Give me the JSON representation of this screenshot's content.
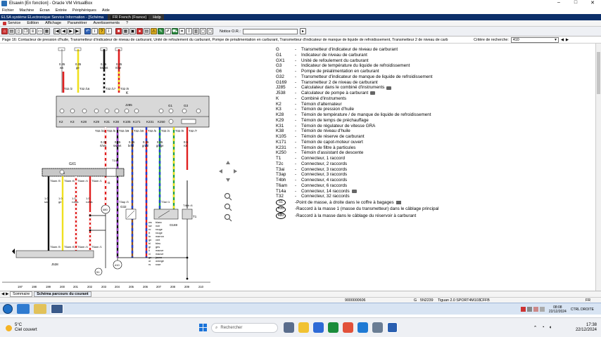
{
  "window": {
    "title": "Elsawin [En fonction] - Oracle VM VirtualBox",
    "controls": [
      "–",
      "□",
      "✕"
    ]
  },
  "vbox_menu": [
    "Fichier",
    "Machine",
    "Écran",
    "Entrée",
    "Périphériques",
    "Aide"
  ],
  "guest_window": {
    "title": "ELSA système ELectronique Service Information - [Schéma",
    "lang": "FR French (France)",
    "help": "Help"
  },
  "elsa_menu": [
    "Service",
    "Edition",
    "Affichage",
    "Paramètrer",
    "Avertissements",
    "?"
  ],
  "notice": {
    "label": "Notice O.R.:",
    "value": ""
  },
  "page": {
    "title": "Page 16: Contacteur de pression d'huile, Transmetteur d'indicateur de niveau de carburant, Unité de refoulement du carburant, Pompe de préalimentation en carburant, Transmetteur d'indicateur de manque de liquide de refroidissement, Transmetteur 2 de niveau de carb"
  },
  "search_criteria": {
    "label": "Critère de recherche:",
    "value": "410"
  },
  "legend": [
    {
      "code": "G",
      "desc": "Transmetteur d'indicateur de niveau de carburant",
      "cam": false
    },
    {
      "code": "G1",
      "desc": "Indicateur de niveau de carburant",
      "cam": false
    },
    {
      "code": "GX1",
      "desc": "Unité de refoulement du carburant",
      "cam": false
    },
    {
      "code": "G3",
      "desc": "Indicateur de température du liquide de refroidissement",
      "cam": false
    },
    {
      "code": "G6",
      "desc": "Pompe de préalimentation en carburant",
      "cam": false
    },
    {
      "code": "G32",
      "desc": "Transmetteur d'indicateur de manque de liquide de refroidissement",
      "cam": false
    },
    {
      "code": "G169",
      "desc": "Transmetteur 2 de niveau de carburant",
      "cam": false
    },
    {
      "code": "J285",
      "desc": "Calculateur dans le combiné d'instruments",
      "cam": true
    },
    {
      "code": "J538",
      "desc": "Calculateur de pompe à carburant",
      "cam": true
    },
    {
      "code": "K",
      "desc": "Combiné d'instruments",
      "cam": false
    },
    {
      "code": "K2",
      "desc": "Témoin d'alternateur",
      "cam": false
    },
    {
      "code": "K3",
      "desc": "Témoin de pression d'huile",
      "cam": false
    },
    {
      "code": "K28",
      "desc": "Témoin de température / de manque de liquide de refroidissement",
      "cam": false
    },
    {
      "code": "K29",
      "desc": "Témoin de temps de préchauffage",
      "cam": false
    },
    {
      "code": "K31",
      "desc": "Témoin de régulateur de vitesse GRA",
      "cam": false
    },
    {
      "code": "K38",
      "desc": "Témoin de niveau d'huile",
      "cam": false
    },
    {
      "code": "K105",
      "desc": "Témoin de réserve de carburant",
      "cam": false
    },
    {
      "code": "K171",
      "desc": "Témoin de capot-moteur ouvert",
      "cam": false
    },
    {
      "code": "K231",
      "desc": "Témoin de filtre à particules",
      "cam": false
    },
    {
      "code": "K250",
      "desc": "Témoin d'assistant de descente",
      "cam": false
    },
    {
      "code": "T1",
      "desc": "Connecteur, 1 raccord",
      "cam": false
    },
    {
      "code": "T2c",
      "desc": "Connecteur, 2 raccords",
      "cam": false
    },
    {
      "code": "T3ai",
      "desc": "Connecteur, 3 raccords",
      "cam": false
    },
    {
      "code": "T3ap",
      "desc": "Connecteur, 3 raccords",
      "cam": false
    },
    {
      "code": "T4bh",
      "desc": "Connecteur, 4 raccords",
      "cam": false
    },
    {
      "code": "T6am",
      "desc": "Connecteur, 6 raccords",
      "cam": false
    },
    {
      "code": "T14a",
      "desc": "Connecteur, 14 raccords",
      "cam": true
    },
    {
      "code": "T32",
      "desc": "Connecteur, 32 raccords",
      "cam": false
    }
  ],
  "legend_symbols": [
    {
      "code": "51",
      "desc": "Point de masse, à droite dans le coffre à bagages",
      "cam": true
    },
    {
      "code": "410",
      "desc": "Raccord à la masse 1 (masse du transmetteur) dans le câblage principal",
      "cam": false
    },
    {
      "code": "480",
      "desc": "Raccord à la masse dans le câblage du réservoir à carburant",
      "cam": false
    }
  ],
  "schema": {
    "top_wires": [
      {
        "sec": "0.35",
        "col": "ws"
      },
      {
        "sec": "0.35",
        "col": "ge"
      },
      {
        "sec": "0.35",
        "col": "sw/ws"
      },
      {
        "sec": "0.35",
        "col": "rt/ge"
      }
    ],
    "top_connectors": [
      "T32 /2",
      "T32 /16",
      "T32 /17",
      "T32 /8"
    ],
    "k_label": "K",
    "j285": "J285",
    "k_row": [
      "K2",
      "K3",
      "K28",
      "K29",
      "K31",
      "K38",
      "K105",
      "K171",
      "K231",
      "K250"
    ],
    "gauges": [
      "G1",
      "G3"
    ],
    "t32_row": [
      "T32 /6",
      "T32 /29",
      "T32 /20",
      "T32 /5",
      "T32 /4",
      "T32 /9",
      "T32 /7",
      "T32 /31"
    ],
    "mid_wires": [
      {
        "sec": "0.35",
        "col": "rt/ws"
      },
      {
        "sec": "0.35",
        "col": "sw/ws"
      },
      {
        "sec": "0.35",
        "col": "br/bl"
      },
      {
        "sec": "0.35",
        "col": "gn/bl"
      },
      {
        "sec": "0.35",
        "col": "gn/ge"
      },
      {
        "sec": "0.5",
        "col": "rot"
      }
    ],
    "component_labels": {
      "gx1": "GX1",
      "g6": "G6",
      "g": "G",
      "g169": "G169",
      "g32": "G32",
      "j538": "J538",
      "t1": "T1",
      "t14a": "T14a"
    },
    "bottom_connectors": [
      "T6am /5",
      "T6am /6",
      "T6am /4",
      "T6am /1",
      "T3ai /1",
      "T3ai /3",
      "T3ap /3",
      "T3ap /1",
      "T4bh /4"
    ],
    "masses": [
      "480",
      "410",
      "51"
    ],
    "color_key": [
      {
        "code": "ws",
        "name": "blanc"
      },
      {
        "code": "sw",
        "name": "noir"
      },
      {
        "code": "ro",
        "name": "rouge"
      },
      {
        "code": "rt",
        "name": "rouge"
      },
      {
        "code": "br",
        "name": "marron"
      },
      {
        "code": "gn",
        "name": "vert"
      },
      {
        "code": "bl",
        "name": "bleu"
      },
      {
        "code": "gr",
        "name": "gris"
      },
      {
        "code": "li",
        "name": "mauve"
      },
      {
        "code": "vi",
        "name": "mauve"
      },
      {
        "code": "ge",
        "name": "jaune"
      },
      {
        "code": "or",
        "name": "orange"
      },
      {
        "code": "rs",
        "name": "rose"
      }
    ],
    "bottom_numbers": [
      "197",
      "198",
      "199",
      "200",
      "201",
      "202",
      "203",
      "204",
      "205",
      "206",
      "207",
      "208",
      "209",
      "210"
    ]
  },
  "bottom_tabs": [
    "Sommaire",
    "Schéma parcours du courant"
  ],
  "status": {
    "ref": "9000000606",
    "g": "G",
    "code": "5N2239",
    "model": "Tiguan 2.0 SPORT4M103",
    "eng": "CFFB",
    "lang": "FR"
  },
  "guest_clock": {
    "time": "08:08",
    "date": "22/12/2024"
  },
  "guest_tray_label": "CTRL DROITE",
  "host": {
    "weather": {
      "temp": "5°C",
      "desc": "Ciel couvert"
    },
    "search_placeholder": "Rechercher",
    "clock": {
      "time": "17:38",
      "date": "22/12/2024"
    }
  },
  "colors": {
    "accent": "#0c2f6a",
    "wire_red": "#d82020",
    "wire_yellow": "#f0e020",
    "wire_blue": "#2040d0",
    "wire_green": "#20a040",
    "wire_violet": "#8a2fb0"
  }
}
